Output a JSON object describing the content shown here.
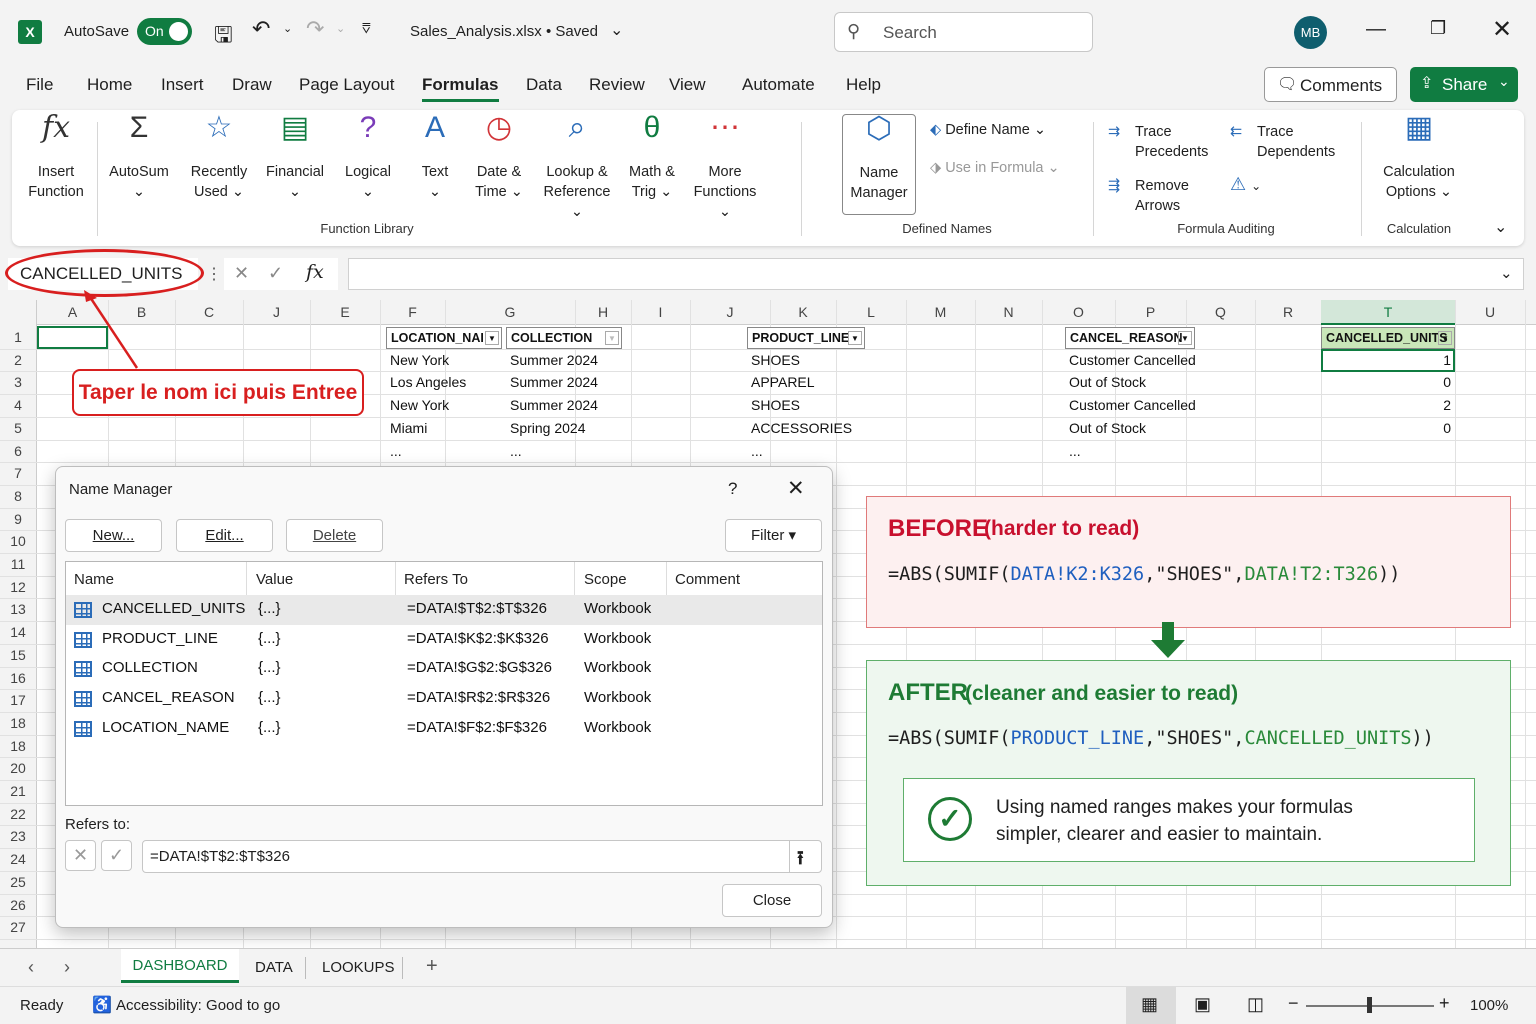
{
  "titlebar": {
    "autosave_label": "AutoSave",
    "toggle_label": "On",
    "filename": "Sales_Analysis.xlsx",
    "saved": "•  Saved",
    "search_placeholder": "Search",
    "user_initials": "MB"
  },
  "menu": {
    "items": [
      "File",
      "Home",
      "Insert",
      "Draw",
      "Page Layout",
      "Formulas",
      "Data",
      "Review",
      "View",
      "Automate",
      "Help"
    ],
    "active": "Formulas",
    "comments": "Comments",
    "share": "Share"
  },
  "ribbon": {
    "function_library": {
      "insert_function": [
        "Insert",
        "Function"
      ],
      "autosum": "AutoSum",
      "recently_used": [
        "Recently",
        "Used"
      ],
      "financial": "Financial",
      "logical": "Logical",
      "text": "Text",
      "date_time": [
        "Date &",
        "Time"
      ],
      "lookup": [
        "Lookup &",
        "Reference"
      ],
      "math": [
        "Math &",
        "Trig"
      ],
      "more": [
        "More",
        "Functions"
      ],
      "group": "Function Library"
    },
    "defined_names": {
      "name_manager": [
        "Name",
        "Manager"
      ],
      "define_name": "Define Name",
      "use_in_formula": "Use in Formula",
      "group": "Defined Names"
    },
    "auditing": {
      "trace_precedents": [
        "Trace",
        "Precedents"
      ],
      "trace_dependents": [
        "Trace",
        "Dependents"
      ],
      "remove_arrows": [
        "Remove",
        "Arrows"
      ],
      "group": "Formula Auditing"
    },
    "calculation": {
      "options": [
        "Calculation",
        "Options"
      ],
      "group": "Calculation"
    }
  },
  "formula_bar": {
    "name_box": "CANCELLED_UNITS",
    "content": ""
  },
  "annotation": {
    "callout": "Taper le nom ici puis Entree"
  },
  "columns": [
    "A",
    "B",
    "C",
    "J",
    "E",
    "F",
    "G",
    "H",
    "I",
    "J",
    "K",
    "L",
    "M",
    "N",
    "O",
    "P",
    "Q",
    "R",
    "T",
    "U"
  ],
  "rows": [
    "1",
    "2",
    "3",
    "4",
    "5",
    "6",
    "7",
    "8",
    "9",
    "10",
    "11",
    "12",
    "13",
    "14",
    "15",
    "16",
    "17",
    "18",
    "18",
    "20",
    "21",
    "22",
    "23",
    "24",
    "25",
    "26",
    "27"
  ],
  "sheet": {
    "headers": {
      "location": "LOCATION_NAI",
      "collection": "COLLECTION",
      "product": "PRODUCT_LINE",
      "cancel": "CANCEL_REASON",
      "units": "CANCELLED_UNITS"
    },
    "location": [
      "New York",
      "Los Angeles",
      "New York",
      "Miami",
      "..."
    ],
    "collection": [
      "Summer 2024",
      "Summer 2024",
      "Summer 2024",
      "Spring 2024",
      "..."
    ],
    "product": [
      "SHOES",
      "APPAREL",
      "SHOES",
      "ACCESSORIES",
      "..."
    ],
    "cancel": [
      "Customer Cancelled",
      "Out of Stock",
      "Customer Cancelled",
      "Out of Stock",
      "..."
    ],
    "units": [
      "1",
      "0",
      "2",
      "0"
    ]
  },
  "dialog": {
    "title": "Name Manager",
    "help": "?",
    "new": "New...",
    "edit": "Edit...",
    "delete": "Delete",
    "filter": "Filter ▾",
    "columns": [
      "Name",
      "Value",
      "Refers To",
      "Scope",
      "Comment"
    ],
    "rows": [
      {
        "name": "CANCELLED_UNITS",
        "value": "{...}",
        "refers": "=DATA!$T$2:$T$326",
        "scope": "Workbook"
      },
      {
        "name": "PRODUCT_LINE",
        "value": "{...}",
        "refers": "=DATA!$K$2:$K$326",
        "scope": "Workbook"
      },
      {
        "name": "COLLECTION",
        "value": "{...}",
        "refers": "=DATA!$G$2:$G$326",
        "scope": "Workbook"
      },
      {
        "name": "CANCEL_REASON",
        "value": "{...}",
        "refers": "=DATA!$R$2:$R$326",
        "scope": "Workbook"
      },
      {
        "name": "LOCATION_NAME",
        "value": "{...}",
        "refers": "=DATA!$F$2:$F$326",
        "scope": "Workbook"
      }
    ],
    "refers_label": "Refers to:",
    "refers_value": "=DATA!$T$2:$T$326",
    "close": "Close"
  },
  "before": {
    "title": "BEFORE",
    "subtitle": "(harder to read)",
    "f_start": "=ABS(SUMIF(",
    "f_r1": "DATA!K2:K326",
    "f_mid": ",\"SHOES\",",
    "f_r2": "DATA!T2:T326",
    "f_end": "))"
  },
  "after": {
    "title": "AFTER",
    "subtitle": "(cleaner and easier to read)",
    "f_start": "=ABS(SUMIF(",
    "f_r1": "PRODUCT_LINE",
    "f_mid": ",\"SHOES\",",
    "f_r2": "CANCELLED_UNITS",
    "f_end": "))",
    "note1": "Using named ranges makes your formulas",
    "note2": "simpler, clearer and easier to maintain."
  },
  "tabs": {
    "items": [
      "DASHBOARD",
      "DATA",
      "LOOKUPS"
    ],
    "active": "DASHBOARD"
  },
  "status": {
    "ready": "Ready",
    "accessibility": "Accessibility: Good to go",
    "zoom": "100%"
  },
  "colors": {
    "excel_green": "#107c41",
    "before_red": "#c8102e",
    "after_green": "#1e7b34",
    "range_blue": "#1f5fbf",
    "range_green": "#2a8a3a"
  }
}
